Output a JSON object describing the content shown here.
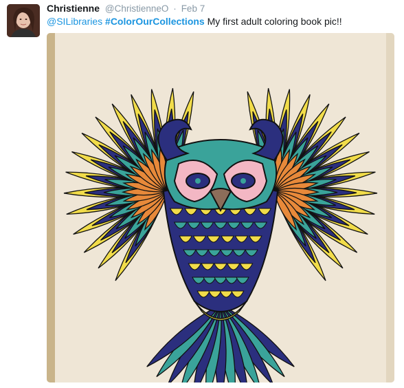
{
  "tweet": {
    "author_name": "Christienne",
    "author_handle": "@ChristienneO",
    "separator": "·",
    "timestamp": "Feb 7",
    "mention": "@SILibraries",
    "hashtag": "#ColorOurCollections",
    "text": "My first adult coloring book pic!!",
    "avatar_icon": "user-avatar",
    "media_description_icon": "owl-coloring-page-image"
  },
  "colors": {
    "link": "#1b95e0",
    "name": "#14171a",
    "meta": "#8899a6",
    "feather_teal": "#3aa39a",
    "feather_navy": "#2b2f7e",
    "feather_yellow": "#f1dc4a",
    "feather_orange": "#e7893a",
    "owl_pink": "#f3b7c4"
  }
}
